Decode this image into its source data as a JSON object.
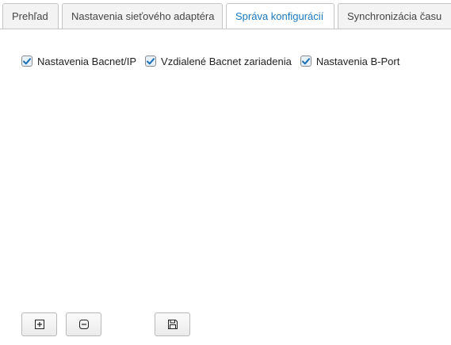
{
  "tabs": [
    {
      "label": "Prehľad",
      "active": false
    },
    {
      "label": "Nastavenia sieťového adaptéra",
      "active": false
    },
    {
      "label": "Správa konfigurácií",
      "active": true
    },
    {
      "label": "Synchronizácia času",
      "active": false
    }
  ],
  "checkboxes": [
    {
      "label": "Nastavenia Bacnet/IP",
      "checked": true
    },
    {
      "label": "Vzdialené Bacnet zariadenia",
      "checked": true
    },
    {
      "label": "Nastavenia B-Port",
      "checked": true
    }
  ],
  "buttons": [
    {
      "icon": "plus-box-icon"
    },
    {
      "icon": "minus-box-icon"
    },
    {
      "icon": "floppy-disk-icon"
    }
  ],
  "colors": {
    "active_tab_text": "#1a78c2",
    "checkbox_check": "#1a6fb5",
    "border": "#c5c5c5"
  }
}
